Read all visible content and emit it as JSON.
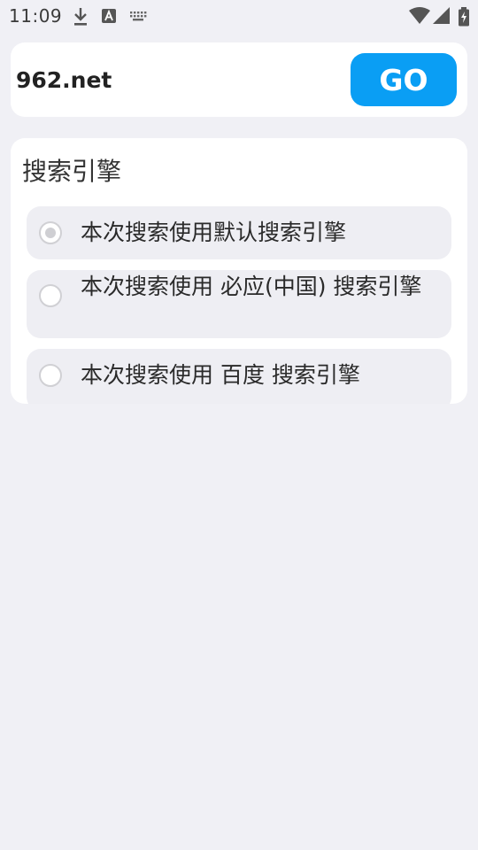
{
  "status_bar": {
    "time": "11:09",
    "icons": [
      "download-icon",
      "text-a-icon",
      "keyboard-icon",
      "wifi-icon",
      "signal-icon",
      "battery-icon"
    ]
  },
  "url_bar": {
    "value": "962.net",
    "go_label": "GO"
  },
  "search_engine": {
    "title": "搜索引擎",
    "options": [
      {
        "label": "本次搜索使用默认搜索引擎",
        "selected": true
      },
      {
        "label": "本次搜索使用 必应(中国) 搜索引擎",
        "selected": false
      },
      {
        "label": "本次搜索使用 百度 搜索引擎",
        "selected": false
      }
    ]
  },
  "colors": {
    "accent": "#0a9ef4",
    "background": "#f0f0f5",
    "card": "#ffffff",
    "option_bg": "#eeeef3"
  }
}
